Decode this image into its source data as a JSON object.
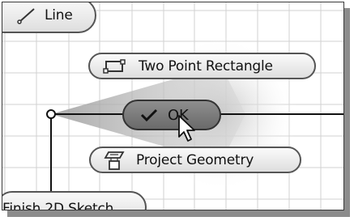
{
  "marking_menu": {
    "line_label": "Line",
    "rectangle_label": "Two Point Rectangle",
    "ok_label": "OK",
    "project_label": "Project Geometry",
    "finish_label": "Finish 2D Sketch",
    "icons": {
      "line": "line-icon",
      "rectangle": "rectangle-icon",
      "ok": "checkmark-icon",
      "project": "project-geometry-icon",
      "cursor": "mouse-pointer-icon"
    }
  },
  "colors": {
    "grid": "#cfcfcf",
    "wedge": "#c8c8c8",
    "ok_fill": "#7c7c7c"
  }
}
